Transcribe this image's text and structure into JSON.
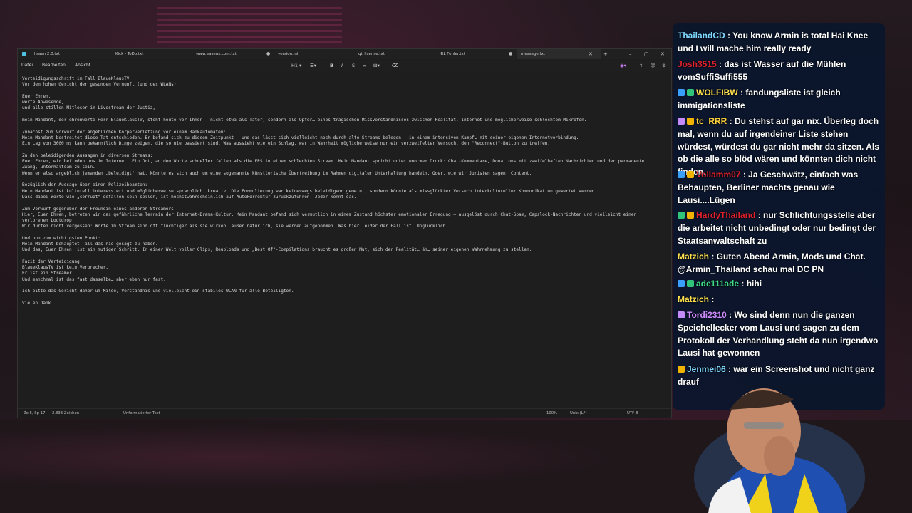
{
  "editor": {
    "tabs": [
      {
        "label": "lisaen 2.0.txt",
        "active": false
      },
      {
        "label": "Kick - ToDo.txt",
        "active": false
      },
      {
        "label": "www.easeus.com.txt",
        "active": false
      },
      {
        "label": "version.ini",
        "active": false
      },
      {
        "label": "qt_license.txt",
        "active": false
      },
      {
        "label": "IRL Fehler.txt",
        "active": false
      },
      {
        "label": "message.txt",
        "active": true
      }
    ],
    "new_tab": "+",
    "menu": [
      "Datei",
      "Bearbeiten",
      "Ansicht"
    ],
    "heading_select": "H1",
    "lines": [
      "Verteidigungsschrift im Fall BlaueKlausTV",
      "Vor dem hohen Gericht der gesunden Vernunft (und des WLANs)",
      "",
      "Euer Ehren,",
      "werte Anwesende,",
      "und alle stillen Mitleser im Livestream der Justiz,",
      "",
      "mein Mandant, der ehrenwerte Herr BlaueKlausTV, steht heute vor Ihnen – nicht etwa als Täter, sondern als Opfer… eines tragischen Missverständnisses zwischen Realität, Internet und möglicherweise schlechtem Mikrofon.",
      "",
      "Zunächst zum Vorwurf der angeblichen Körperverletzung vor einem Bankautomaten:",
      "Mein Mandant bestreitet diese Tat entschieden. Er befand sich zu diesem Zeitpunkt – und das lässt sich vielleicht noch durch alte Streams belegen – in einem intensiven Kampf… mit seiner eigenen Internetverbindung.",
      "Ein Lag von 3000 ms kann bekanntlich Dinge zeigen, die so nie passiert sind. Was aussieht wie ein Schlag, war in Wahrheit möglicherweise nur ein verzweifelter Versuch, den \"Reconnect\"-Button zu treffen.",
      "",
      "Zu den beleidigenden Aussagen in diversen Streams:",
      "Euer Ehren, wir befinden uns im Internet. Ein Ort, an dem Worte schneller fallen als die FPS in einem schlechten Stream. Mein Mandant spricht unter enormem Druck: Chat-Kommentare, Donations mit zweifelhaften Nachrichten und der permanente",
      "Zwang, unterhaltsam zu sein.",
      "Wenn er also angeblich jemanden „beleidigt\" hat, könnte es sich auch um eine sogenannte künstlerische Übertreibung im Rahmen digitaler Unterhaltung handeln. Oder, wie wir Juristen sagen: Content.",
      "",
      "Bezüglich der Aussage über einen Polizeibeamten:",
      "Mein Mandant ist kulturell interessiert und möglicherweise sprachlich… kreativ. Die Formulierung war keineswegs beleidigend gemeint, sondern könnte als missglückter Versuch interkultureller Kommunikation gewertet werden.",
      "Dass dabei Worte wie „corrupt\" gefallen sein sollen, ist höchstwahrscheinlich auf Autokorrektur zurückzuführen. Jeder kennt das.",
      "",
      "Zum Vorwurf gegenüber der Freundin eines anderen Streamers:",
      "Hier, Euer Ehren, betreten wir das gefährliche Terrain der Internet-Drama-Kultur. Mein Mandant befand sich vermutlich in einem Zustand höchster emotionaler Erregung – ausgelöst durch Chat-Spam, Capslock-Nachrichten und vielleicht einen",
      "verlorenen Lootdrop.",
      "Wir dürfen nicht vergessen: Worte im Stream sind oft flüchtiger als sie wirken… außer natürlich, sie werden aufgenommen. Was hier leider der Fall ist. Unglücklich.",
      "",
      "Und nun zum wichtigsten Punkt:",
      "Mein Mandant behauptet, all das nie gesagt zu haben.",
      "Und das, Euer Ehren, ist ein mutiger Schritt. In einer Welt voller Clips, Reuploads und „Best Of\"-Compilations braucht es großen Mut, sich der Realität… äh… seiner eigenen Wahrnehmung zu stellen.",
      "",
      "Fazit der Verteidigung:",
      "BlaueKlausTV ist kein Verbrecher.",
      "Er ist ein Streamer.",
      "Und manchmal ist das fast dasselbe… aber eben nur fast.",
      "",
      "Ich bitte das Gericht daher um Milde, Verständnis und vielleicht ein stabiles WLAN für alle Beteiligten.",
      "",
      "Vielen Dank."
    ],
    "status": {
      "position": "Ze 5, Sp 17",
      "chars": "2.833 Zeichen",
      "format": "Unformatierter Text",
      "zoom": "100%",
      "eol": "Unix (LF)",
      "encoding": "UTF-8"
    }
  },
  "chat": {
    "messages": [
      {
        "user": "ThailandCD",
        "color": "#7fd8ff",
        "text": ": You know Armin is total Hai Knee und I will mache him really ready",
        "badges": []
      },
      {
        "user": "Josh3515",
        "color": "#e0202a",
        "text": ": das ist Wasser auf die Mühlen vomSuffiSuffi555",
        "badges": []
      },
      {
        "user": "WOLFIBW",
        "color": "#ffe14d",
        "text": ": fandungsliste ist gleich immigationsliste",
        "badges": [
          "#3aa0ff",
          "#2fc47a"
        ]
      },
      {
        "user": "tc_RRR",
        "color": "#ffd23a",
        "text": ": Du stehst auf gar nix. Überleg doch mal, wenn du auf irgendeiner Liste stehen würdest, würdest du gar nicht mehr da sitzen. Als ob die alle so blöd wären und könnten dich nicht finden.",
        "badges": [
          "#c58af9",
          "#f0b400"
        ]
      },
      {
        "user": "Vollamm07",
        "color": "#e0202a",
        "text": ": Ja Geschwätz, einfach was Behaupten, Berliner machts genau wie Lausi....Lügen",
        "badges": [
          "#3aa0ff",
          "#f0b400"
        ]
      },
      {
        "user": "HardyThailand",
        "color": "#e0202a",
        "text": ": nur Schlichtungsstelle aber die arbeitet nicht unbedingt oder nur bedingt der Staatsanwaltschaft zu",
        "badges": [
          "#2fc47a",
          "#f0b400"
        ]
      },
      {
        "user": "Matzich",
        "color": "#ffe14d",
        "text": ": Guten Abend Armin, Mods und Chat. @Armin_Thailand schau mal DC PN",
        "badges": []
      },
      {
        "user": "ade111ade",
        "color": "#3ddc84",
        "text": ": hihi",
        "badges": [
          "#3aa0ff",
          "#2fc47a"
        ]
      },
      {
        "user": "Matzich",
        "color": "#ffe14d",
        "text": ":",
        "badges": []
      },
      {
        "user": "Tordi2310",
        "color": "#d08cff",
        "text": ": Wo sind denn nun die ganzen Speichellecker vom Lausi und sagen zu dem Protokoll der Verhandlung steht da nun irgendwo Lausi hat gewonnen",
        "badges": [
          "#c58af9"
        ]
      },
      {
        "user": "Jenmei06",
        "color": "#7fd8ff",
        "text": ": war ein Screenshot und nicht ganz drauf",
        "badges": [
          "#f0b400"
        ]
      }
    ]
  }
}
